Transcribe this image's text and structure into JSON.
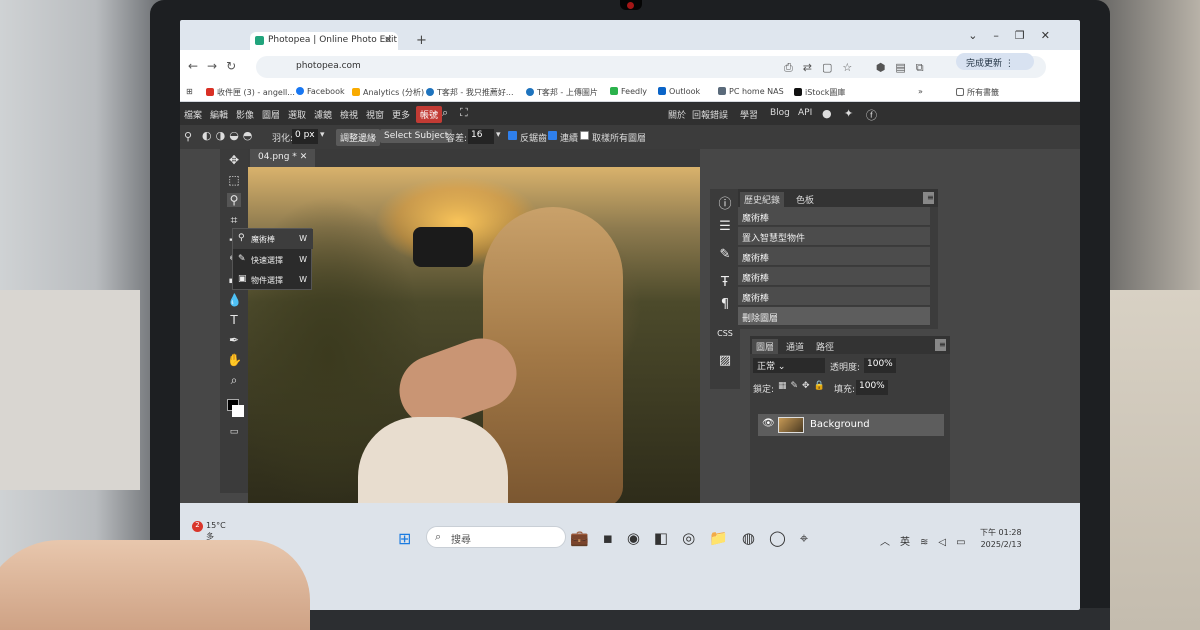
{
  "browser": {
    "tab_title": "Photopea | Online Photo Edit",
    "url": "photopea.com",
    "update_button": "完成更新",
    "bookmarks": [
      "收件匣 (3) - angell...",
      "Facebook",
      "Analytics (分析)",
      "T客邦 - 我只推薦好...",
      "T客邦 - 上傳圖片",
      "Feedly",
      "Outlook",
      "PC home NAS",
      "iStock圖庫"
    ],
    "all_bookmarks": "所有書籤"
  },
  "menubar": {
    "items": [
      "檔案",
      "編輯",
      "影像",
      "圖層",
      "選取",
      "濾鏡",
      "檢視",
      "視窗",
      "更多"
    ],
    "account": "帳號",
    "right_links": [
      "關於",
      "回報錯誤",
      "學習",
      "Blog",
      "API"
    ]
  },
  "options": {
    "feather_label": "羽化:",
    "feather_value": "0 px",
    "refine_edge": "調整邊緣",
    "select_subject": "Select Subject",
    "tolerance_label": "容差:",
    "tolerance_value": "16",
    "antialias": "反鋸齒",
    "contiguous": "連續",
    "sample_all": "取樣所有圖層"
  },
  "document": {
    "tab": "04.png *"
  },
  "tool_popup": [
    {
      "label": "魔術棒",
      "key": "W"
    },
    {
      "label": "快速選擇",
      "key": "W"
    },
    {
      "label": "物件選擇",
      "key": "W"
    }
  ],
  "history_panel": {
    "tabs": [
      "歷史紀錄",
      "色板"
    ],
    "items": [
      "魔術棒",
      "置入智慧型物件",
      "魔術棒",
      "魔術棒",
      "魔術棒",
      "刪除圖層"
    ]
  },
  "layers_panel": {
    "tabs": [
      "圖層",
      "通道",
      "路徑"
    ],
    "blend_mode": "正常",
    "opacity_label": "透明度:",
    "opacity_value": "100%",
    "lock_label": "鎖定:",
    "fill_label": "填充:",
    "fill_value": "100%",
    "layer_name": "Background"
  },
  "taskbar": {
    "weather_alert": "2",
    "temperature": "15°C",
    "weather": "多雲",
    "search_placeholder": "搜尋",
    "ime": "英",
    "time": "下午 01:28",
    "date": "2025/2/13"
  }
}
